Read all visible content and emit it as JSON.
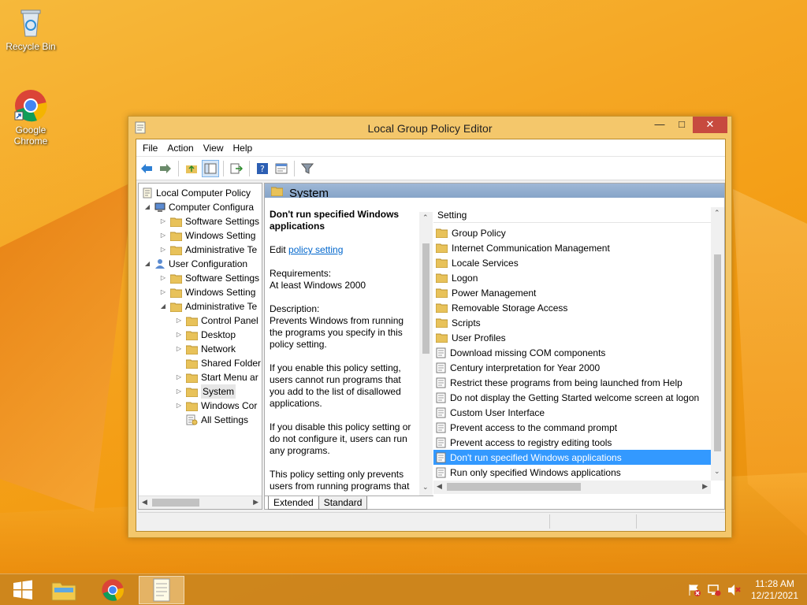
{
  "desktop": {
    "icons": [
      {
        "label": "Recycle Bin"
      },
      {
        "label": "Google Chrome"
      }
    ]
  },
  "window": {
    "title": "Local Group Policy Editor",
    "min_glyph": "—",
    "max_glyph": "□",
    "close_glyph": "✕"
  },
  "menu": [
    "File",
    "Action",
    "View",
    "Help"
  ],
  "tree": [
    "Local Computer Policy",
    "Computer Configura",
    "Software Settings",
    "Windows Setting",
    "Administrative Te",
    "User Configuration",
    "Software Settings",
    "Windows Setting",
    "Administrative Te",
    "Control Panel",
    "Desktop",
    "Network",
    "Shared Folder",
    "Start Menu ar",
    "System",
    "Windows Cor",
    "All Settings"
  ],
  "pane": {
    "header": "System",
    "policy_title": "Don't run specified Windows applications",
    "edit_prefix": "Edit ",
    "edit_link": "policy setting",
    "requirements_label": "Requirements:",
    "requirements_value": "At least Windows 2000",
    "description_label": "Description:",
    "description_text": "Prevents Windows from running the programs you specify in this policy setting.",
    "enable_text": "If you enable this policy setting, users cannot run programs that you add to the list of disallowed applications.",
    "disable_text": "If you disable this policy setting or do not configure it, users can run any programs.",
    "only_text": "This policy setting only prevents users from running programs that"
  },
  "list": {
    "column_header": "Setting",
    "folders": [
      "Group Policy",
      "Internet Communication Management",
      "Locale Services",
      "Logon",
      "Power Management",
      "Removable Storage Access",
      "Scripts",
      "User Profiles"
    ],
    "settings": [
      "Download missing COM components",
      "Century interpretation for Year 2000",
      "Restrict these programs from being launched from Help",
      "Do not display the Getting Started welcome screen at logon",
      "Custom User Interface",
      "Prevent access to the command prompt",
      "Prevent access to registry editing tools",
      "Don't run specified Windows applications",
      "Run only specified Windows applications"
    ]
  },
  "tabs": [
    "Extended",
    "Standard"
  ],
  "taskbar": {
    "time": "11:28 AM",
    "date": "12/21/2021"
  },
  "colors": {
    "selection": "#3399ff",
    "folder": "#e8c25a",
    "close": "#c74a3f"
  }
}
